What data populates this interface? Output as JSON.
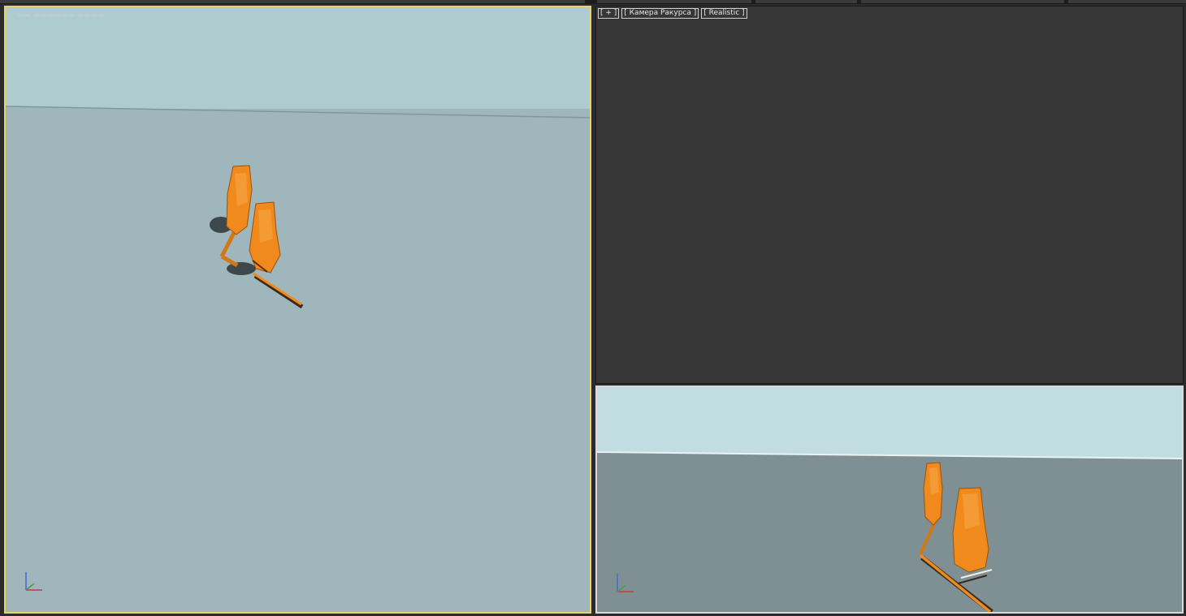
{
  "viewports": {
    "top_right": {
      "labels": [
        "[ + ]",
        "[ Камера Ракурса ]",
        "[ Realistic ]"
      ]
    }
  },
  "colors": {
    "active_viewport_border": "#e8d26a",
    "object_orange": "#f08a1c",
    "left_sky": "#aecbd0",
    "left_ground": "#9fb6bd",
    "right_bottom_sky": "#c1dde2",
    "right_bottom_ground": "#7e9094",
    "dark_viewport": "#363636"
  },
  "icons": {
    "axis_gizmo": "axis-tripod-icon",
    "scene_objects": "robot-arm-model"
  }
}
